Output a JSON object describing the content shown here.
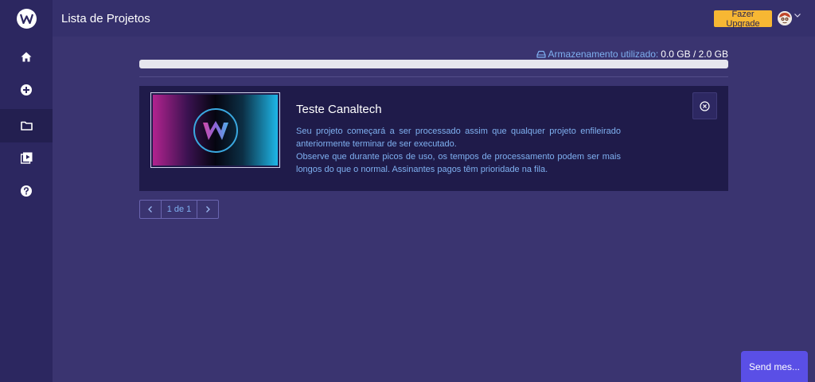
{
  "header": {
    "title": "Lista de Projetos",
    "upgrade_label": "Fazer Upgrade"
  },
  "sidebar": {
    "items": [
      {
        "icon": "home-icon"
      },
      {
        "icon": "plus-circle-icon"
      },
      {
        "icon": "folder-icon",
        "active": true
      },
      {
        "icon": "video-library-icon"
      },
      {
        "icon": "help-icon"
      }
    ]
  },
  "storage": {
    "label": "Armazenamento utilizado:",
    "value": "0.0 GB / 2.0 GB",
    "used_fraction": 0.0
  },
  "project": {
    "title": "Teste Canaltech",
    "desc_line1": "Seu projeto começará a ser processado assim que qualquer projeto enfileirado anteriormente terminar de ser executado.",
    "desc_line2": "Observe que durante picos de uso, os tempos de processamento podem ser mais longos do que o normal. Assinantes pagos têm prioridade na fila."
  },
  "pagination": {
    "label": "1 de 1"
  },
  "chat": {
    "label": "Send mes..."
  },
  "colors": {
    "background": "#3a3470",
    "sidebar": "#2c2760",
    "card": "#1f1b4a",
    "accent_text": "#7fb0f0",
    "upgrade": "#f7b733",
    "chat": "#5a4fe6"
  }
}
